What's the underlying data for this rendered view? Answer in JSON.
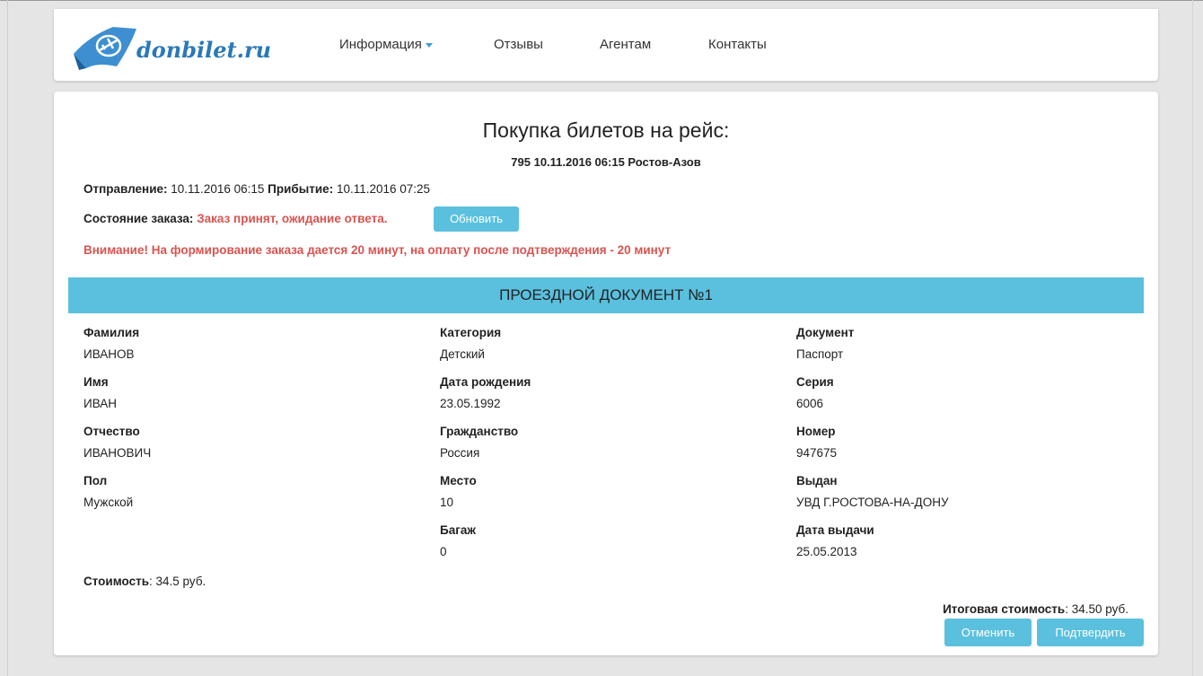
{
  "header": {
    "logo_text": "donbilet.ru",
    "nav": [
      "Информация",
      "Отзывы",
      "Агентам",
      "Контакты"
    ]
  },
  "page": {
    "title": "Покупка билетов на рейс:",
    "route": "795 10.11.2016 06:15 Ростов-Азов",
    "departure_label": "Отправление:",
    "departure_value": "10.11.2016 06:15",
    "arrival_label": "Прибытие:",
    "arrival_value": "10.11.2016 07:25",
    "status_label": "Состояние заказа:",
    "status_value": "Заказ принят, ожидание ответа.",
    "refresh_button": "Обновить",
    "warning": "Внимание! На формирование заказа дается 20 минут, на оплату после подтверждения - 20 минут"
  },
  "ticket": {
    "banner": "ПРОЕЗДНОЙ ДОКУМЕНТ №1",
    "col1": [
      {
        "label": "Фамилия",
        "value": "ИВАНОВ"
      },
      {
        "label": "Имя",
        "value": "ИВАН"
      },
      {
        "label": "Отчество",
        "value": "ИВАНОВИЧ"
      },
      {
        "label": "Пол",
        "value": "Мужской"
      }
    ],
    "col2": [
      {
        "label": "Категория",
        "value": "Детский"
      },
      {
        "label": "Дата рождения",
        "value": "23.05.1992"
      },
      {
        "label": "Гражданство",
        "value": "Россия"
      },
      {
        "label": "Место",
        "value": "10"
      },
      {
        "label": "Багаж",
        "value": "0"
      }
    ],
    "col3": [
      {
        "label": "Документ",
        "value": "Паспорт"
      },
      {
        "label": "Серия",
        "value": "6006"
      },
      {
        "label": "Номер",
        "value": "947675"
      },
      {
        "label": "Выдан",
        "value": "УВД Г.РОСТОВА-НА-ДОНУ"
      },
      {
        "label": "Дата выдачи",
        "value": "25.05.2013"
      }
    ],
    "cost_label": "Стоимость",
    "cost_value": ": 34.5 руб."
  },
  "footer": {
    "total_label": "Итоговая стоимость",
    "total_value": ": 34.50 руб.",
    "cancel_button": "Отменить",
    "confirm_button": "Подтвердить"
  },
  "colors": {
    "accent": "#5bc0de",
    "warning": "#d9534f",
    "logo": "#2a78b8"
  }
}
